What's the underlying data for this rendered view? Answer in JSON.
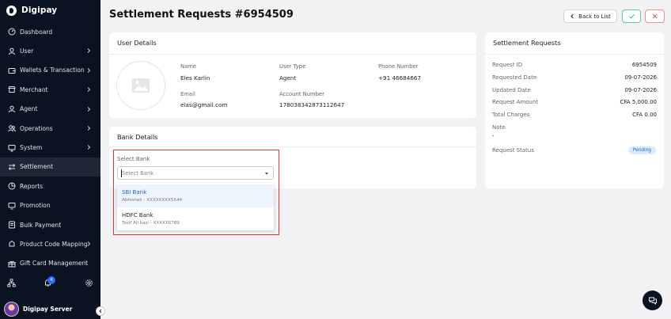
{
  "brand": {
    "name": "Digipay"
  },
  "sidebar": {
    "items": [
      {
        "label": "Dashboard",
        "icon": "dashboard-icon",
        "chevron": false,
        "active": false
      },
      {
        "label": "User",
        "icon": "user-icon",
        "chevron": true,
        "active": false
      },
      {
        "label": "Wallets & Transaction",
        "icon": "wallet-icon",
        "chevron": true,
        "active": false
      },
      {
        "label": "Merchant",
        "icon": "shop-icon",
        "chevron": true,
        "active": false
      },
      {
        "label": "Agent",
        "icon": "agent-icon",
        "chevron": true,
        "active": false
      },
      {
        "label": "Operations",
        "icon": "operations-icon",
        "chevron": true,
        "active": false
      },
      {
        "label": "System",
        "icon": "monitor-icon",
        "chevron": true,
        "active": false
      },
      {
        "label": "Settlement",
        "icon": "transfer-icon",
        "chevron": false,
        "active": true
      },
      {
        "label": "Reports",
        "icon": "reports-icon",
        "chevron": false,
        "active": false
      },
      {
        "label": "Promotion",
        "icon": "promotion-icon",
        "chevron": false,
        "active": false
      },
      {
        "label": "Bulk Payment",
        "icon": "bulk-payment-icon",
        "chevron": false,
        "active": false
      },
      {
        "label": "Product Code Mapping",
        "icon": "mapping-icon",
        "chevron": true,
        "active": false
      },
      {
        "label": "Gift Card Management",
        "icon": "gift-card-icon",
        "chevron": false,
        "active": false
      }
    ],
    "notification_count": "4",
    "user_name": "Digipay Server"
  },
  "header": {
    "title": "Settlement Requests #6954509",
    "back_label": "Back to List"
  },
  "user_details": {
    "title": "User Details",
    "name_label": "Name",
    "name_value": "Eles Karlin",
    "user_type_label": "User Type",
    "user_type_value": "Agent",
    "phone_label": "Phone Number",
    "phone_value": "+91 46684667",
    "email_label": "Email",
    "email_value": "elas@gmail.com",
    "account_label": "Account Number",
    "account_value": "178038342873112647"
  },
  "bank_details": {
    "title": "Bank Details",
    "select_label": "Select Bank",
    "select_placeholder": "Select Bank",
    "options": [
      {
        "name": "SBI Bank",
        "sub": "Abhishek - XXXXXXXX5544"
      },
      {
        "name": "HDFC Bank",
        "sub": "Tosif Ali kazi - XXXXX6789"
      }
    ]
  },
  "settlement_requests": {
    "title": "Settlement Requests",
    "request_id_label": "Request ID",
    "request_id_value": "6954509",
    "requested_date_label": "Requested Date",
    "requested_date_value": "09-07-2026",
    "updated_date_label": "Updated Date",
    "updated_date_value": "09-07-2026",
    "request_amount_label": "Request Amount",
    "request_amount_value": "CFA 5,000.00",
    "total_charges_label": "Total Charges",
    "total_charges_value": "CFA 0.00",
    "note_label": "Note",
    "note_value": "-",
    "status_label": "Request Status",
    "status_value": "Pending"
  },
  "colors": {
    "sidebar_bg": "#0b1222",
    "accent_blue": "#2f6bff",
    "highlight_red": "#e0343b",
    "approve_green": "#5bc8a0",
    "reject_red": "#f08f8f",
    "pending_badge_bg": "#dbe9ff"
  }
}
